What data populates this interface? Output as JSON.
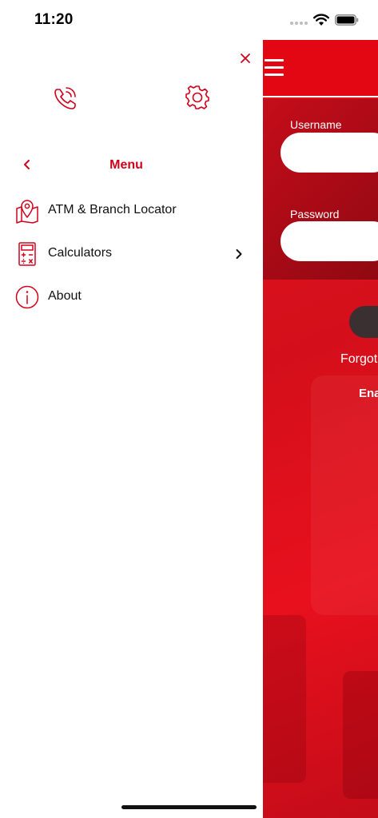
{
  "status_bar": {
    "time": "11:20"
  },
  "drawer": {
    "title": "Menu",
    "items": [
      {
        "label": "ATM & Branch Locator",
        "icon": "map-pin-icon",
        "has_submenu": false
      },
      {
        "label": "Calculators",
        "icon": "calculator-icon",
        "has_submenu": true
      },
      {
        "label": "About",
        "icon": "info-icon",
        "has_submenu": false
      }
    ]
  },
  "login": {
    "username_label": "Username",
    "password_label": "Password",
    "forgot_partial": "Forgot",
    "enable_partial": "Ena"
  },
  "colors": {
    "accent": "#d0021b",
    "brand_red": "#e30613",
    "button_dark": "#3a2f31"
  }
}
